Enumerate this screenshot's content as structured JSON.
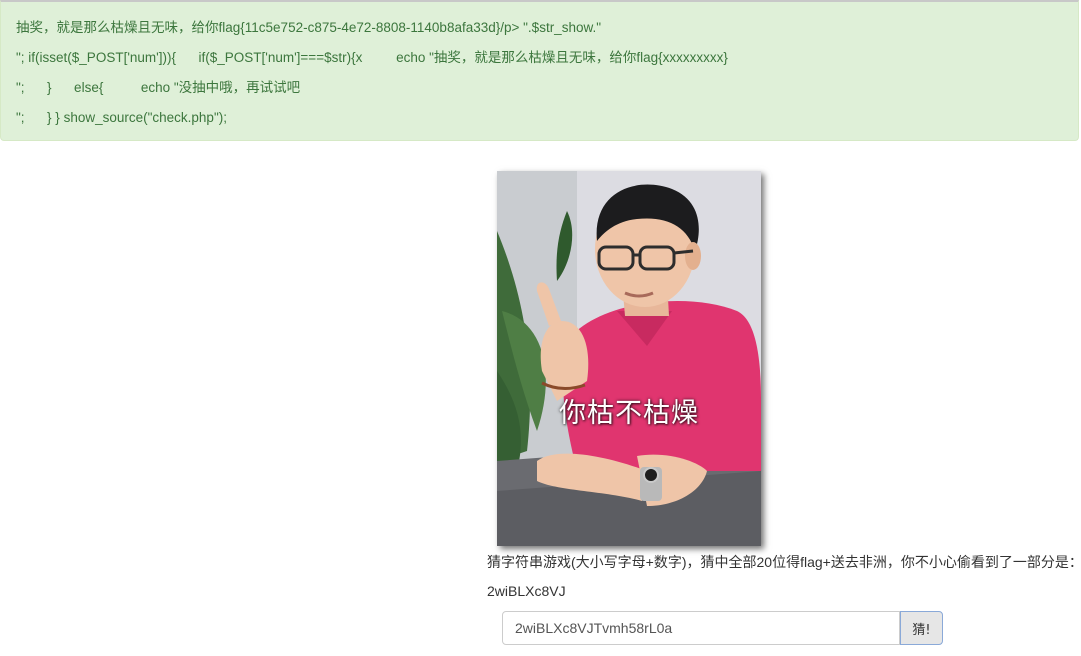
{
  "source_output": {
    "line1": "抽奖，就是那么枯燥且无味，给你flag{11c5e752-c875-4e72-8808-1140b8afa33d}/p> \".$str_show.\"",
    "line2": "\"; if(isset($_POST['num'])){      if($_POST['num']===$str){x         echo \"抽奖，就是那么枯燥且无味，给你flag{xxxxxxxxx}",
    "line3": "\";      }      else{          echo \"没抽中哦，再试试吧",
    "line4": "\";      } } show_source(\"check.php\");"
  },
  "image": {
    "caption": "你枯不枯燥"
  },
  "game": {
    "hint": "猜字符串游戏(大小写字母+数字)，猜中全部20位得flag+送去非洲，你不小心偷看到了一部分是：",
    "partial": "2wiBLXc8VJ",
    "input_value": "2wiBLXc8VJTvmh58rL0a",
    "button_label": "猜!"
  },
  "colors": {
    "alert_bg": "#dff0d8",
    "alert_text": "#3c763d",
    "shirt": "#e0356f"
  }
}
